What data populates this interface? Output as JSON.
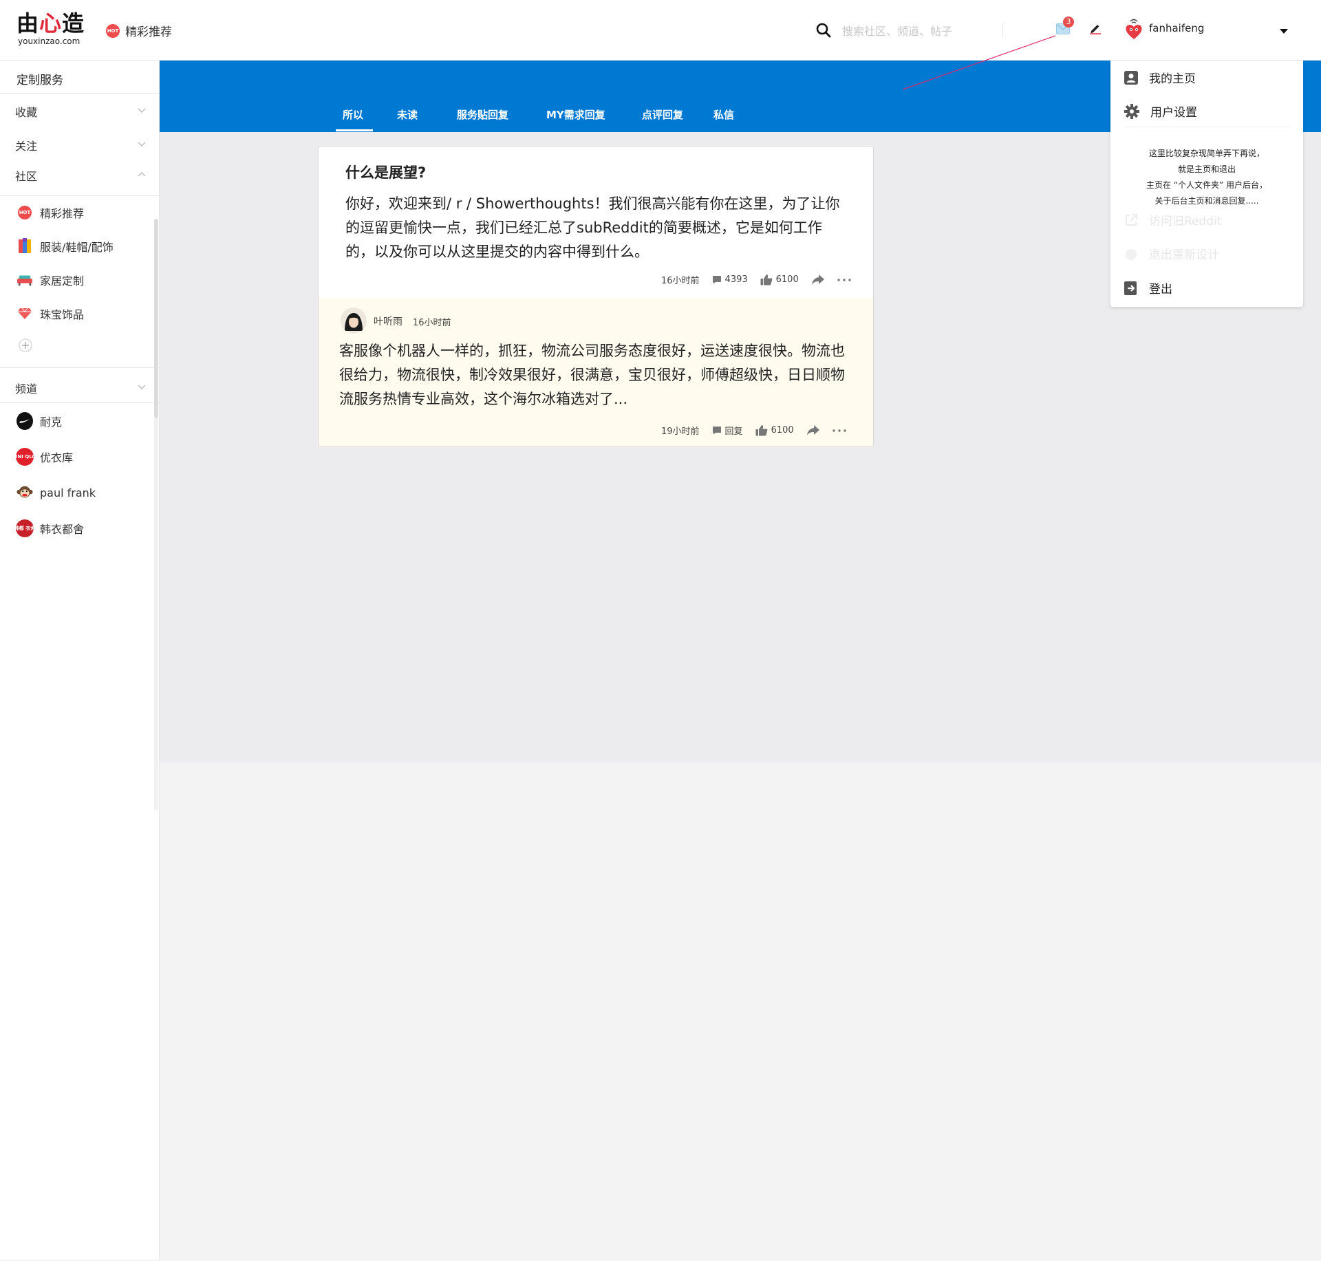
{
  "brand": {
    "logo_text_left": "由",
    "logo_heart": "心",
    "logo_text_right": "造",
    "domain": "youxinzao.com",
    "hot_label": "HOT",
    "current_community": "精彩推荐"
  },
  "header": {
    "search_placeholder": "搜索社区、频道、帖子",
    "mail_badge_count": "3",
    "username": "fanhaifeng"
  },
  "sidebar": {
    "title": "定制服务",
    "sections": {
      "favorites": "收藏",
      "following": "关注",
      "community": "社区",
      "channels": "频道"
    },
    "community_items": [
      {
        "label": "精彩推荐",
        "icon": "hot-icon"
      },
      {
        "label": "服装/鞋帽/配饰",
        "icon": "clothing-icon"
      },
      {
        "label": "家居定制",
        "icon": "sofa-icon"
      },
      {
        "label": "珠宝饰品",
        "icon": "gem-icon"
      }
    ],
    "channel_items": [
      {
        "label": "耐克",
        "icon": "nike-logo",
        "logo_text": ""
      },
      {
        "label": "优衣库",
        "icon": "uniqlo-logo",
        "logo_text": "UNI QLO"
      },
      {
        "label": "paul frank",
        "icon": "paul-frank-logo",
        "logo_text": ""
      },
      {
        "label": "韩衣都舍",
        "icon": "handu-logo",
        "logo_text": "韩都 衣舍"
      }
    ]
  },
  "tabs": [
    {
      "label": "所以",
      "active": true
    },
    {
      "label": "未读"
    },
    {
      "label": "服务贴回复"
    },
    {
      "label": "MY需求回复"
    },
    {
      "label": "点评回复"
    },
    {
      "label": "私信"
    }
  ],
  "post": {
    "title": "什么是展望?",
    "body": "你好，欢迎来到/ r / Showerthoughts！我们很高兴能有你在这里，为了让你的逗留更愉快一点，我们已经汇总了subReddit的简要概述，它是如何工作的，以及你可以从这里提交的内容中得到什么。",
    "time": "16小时前",
    "comments": "4393",
    "likes": "6100"
  },
  "reply": {
    "user": "叶听雨",
    "user_time": "16小时前",
    "body": "客服像个机器人一样的，抓狂，物流公司服务态度很好，运送速度很快。物流也很给力，物流很快，制冷效果很好，很满意，宝贝很好，师傅超级快，日日顺物流服务热情专业高效，这个海尔冰箱选对了...",
    "time": "19小时前",
    "reply_label": "回复",
    "likes": "6100"
  },
  "dropdown": {
    "my_home": "我的主页",
    "user_settings": "用户设置",
    "faded_item_1": "访问旧Reddit",
    "faded_item_2": "退出重新设计",
    "logout": "登出",
    "note_lines": [
      "这里比较复杂现简单弄下再说，",
      "就是主页和退出",
      "主页在 “个人文件夹” 用户后台，",
      "关于后台主页和消息回复....."
    ]
  },
  "colors": {
    "accent_blue": "#0079d3",
    "badge_red": "#e84c4c",
    "reply_background": "#fffbee"
  }
}
